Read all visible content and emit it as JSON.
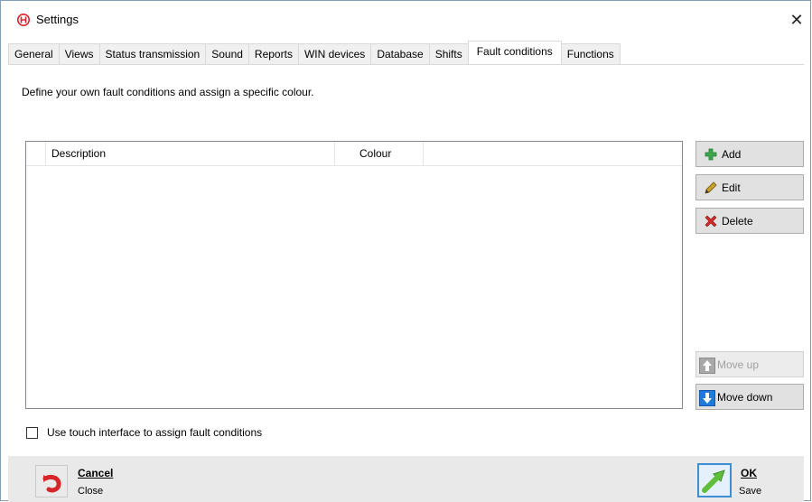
{
  "window": {
    "title": "Settings",
    "close_glyph": "✕"
  },
  "tabs": [
    {
      "label": "General"
    },
    {
      "label": "Views"
    },
    {
      "label": "Status transmission"
    },
    {
      "label": "Sound"
    },
    {
      "label": "Reports"
    },
    {
      "label": "WIN devices"
    },
    {
      "label": "Database"
    },
    {
      "label": "Shifts"
    },
    {
      "label": "Fault conditions",
      "active": true
    },
    {
      "label": "Functions"
    }
  ],
  "page": {
    "intro": "Define your own fault conditions and assign a specific colour."
  },
  "table": {
    "columns": [
      "",
      "Description",
      "Colour",
      ""
    ],
    "rows": []
  },
  "buttons": {
    "add": "Add",
    "edit": "Edit",
    "delete": "Delete",
    "move_up": "Move up",
    "move_down": "Move down"
  },
  "checkbox": {
    "label": "Use touch interface to assign fault conditions",
    "checked": false
  },
  "footer": {
    "cancel_label": "Cancel",
    "cancel_sub": "Close",
    "ok_label": "OK",
    "ok_sub": "Save"
  },
  "icons": {
    "app": "app-logo-icon",
    "add": "plus-icon",
    "edit": "pencil-icon",
    "delete": "delete-x-icon",
    "move_up": "arrow-up-icon",
    "move_down": "arrow-down-icon",
    "cancel": "undo-arrow-icon",
    "ok": "ok-arrow-icon"
  },
  "colors": {
    "accent_blue": "#3a8fd6",
    "add_green": "#3aa64b",
    "delete_red": "#d22b2b",
    "cancel_red": "#d7262b",
    "ok_green": "#5fbf3a"
  }
}
